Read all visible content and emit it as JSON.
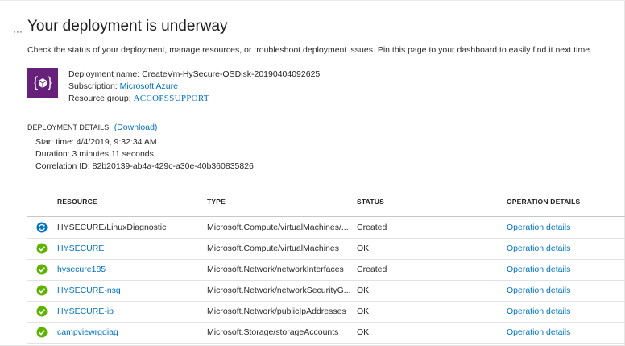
{
  "header": {
    "menu_dots": "···",
    "title": "Your deployment is underway",
    "subtitle": "Check the status of your deployment, manage resources, or troubleshoot deployment issues. Pin this page to your dashboard to easily find it next time."
  },
  "deployment": {
    "icon": "deployment-cube-icon",
    "name_label": "Deployment name:",
    "name_value": "CreateVm-HySecure-OSDisk-20190404092625",
    "subscription_label": "Subscription:",
    "subscription_value": "Microsoft Azure",
    "resource_group_label": "Resource group:",
    "resource_group_value": "ACCOPSSUPPORT"
  },
  "details": {
    "header": "DEPLOYMENT DETAILS",
    "download_link": "(Download)",
    "start_label": "Start time:",
    "start_value": "4/4/2019, 9:32:34 AM",
    "duration_label": "Duration:",
    "duration_value": "3 minutes 11 seconds",
    "correlation_label": "Correlation ID:",
    "correlation_value": "82b20139-ab4a-429c-a30e-40b360835826"
  },
  "table": {
    "columns": [
      "RESOURCE",
      "TYPE",
      "STATUS",
      "OPERATION DETAILS"
    ],
    "rows": [
      {
        "icon": "in-progress-icon",
        "resource": "HYSECURE/LinuxDiagnostic",
        "type": "Microsoft.Compute/virtualMachines/...",
        "status": "Created",
        "operation": "Operation details"
      },
      {
        "icon": "success-check-icon",
        "resource": "HYSECURE",
        "type": "Microsoft.Compute/virtualMachines",
        "status": "OK",
        "operation": "Operation details"
      },
      {
        "icon": "success-check-icon",
        "resource": "hysecure185",
        "type": "Microsoft.Network/networkInterfaces",
        "status": "Created",
        "operation": "Operation details"
      },
      {
        "icon": "success-check-icon",
        "resource": "HYSECURE-nsg",
        "type": "Microsoft.Network/networkSecurityG...",
        "status": "OK",
        "operation": "Operation details"
      },
      {
        "icon": "success-check-icon",
        "resource": "HYSECURE-ip",
        "type": "Microsoft.Network/publicIpAddresses",
        "status": "OK",
        "operation": "Operation details"
      },
      {
        "icon": "success-check-icon",
        "resource": "campviewrgdiag",
        "type": "Microsoft.Storage/storageAccounts",
        "status": "OK",
        "operation": "Operation details"
      }
    ]
  },
  "colors": {
    "link": "#0072c6",
    "success": "#5db300",
    "in_progress": "#0072c6",
    "icon_bg": "#68217a"
  }
}
